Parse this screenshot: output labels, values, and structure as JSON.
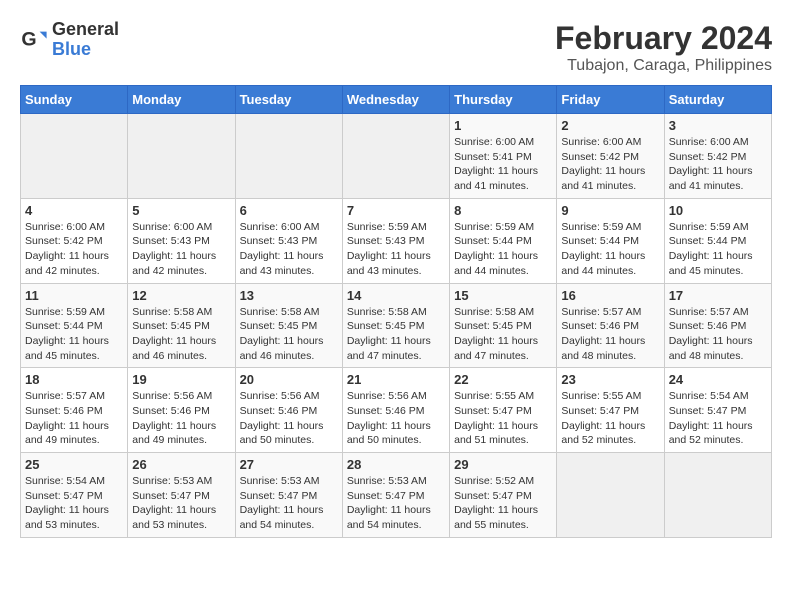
{
  "logo": {
    "text_general": "General",
    "text_blue": "Blue"
  },
  "header": {
    "title": "February 2024",
    "subtitle": "Tubajon, Caraga, Philippines"
  },
  "weekdays": [
    "Sunday",
    "Monday",
    "Tuesday",
    "Wednesday",
    "Thursday",
    "Friday",
    "Saturday"
  ],
  "weeks": [
    [
      {
        "day": "",
        "info": ""
      },
      {
        "day": "",
        "info": ""
      },
      {
        "day": "",
        "info": ""
      },
      {
        "day": "",
        "info": ""
      },
      {
        "day": "1",
        "info": "Sunrise: 6:00 AM\nSunset: 5:41 PM\nDaylight: 11 hours and 41 minutes."
      },
      {
        "day": "2",
        "info": "Sunrise: 6:00 AM\nSunset: 5:42 PM\nDaylight: 11 hours and 41 minutes."
      },
      {
        "day": "3",
        "info": "Sunrise: 6:00 AM\nSunset: 5:42 PM\nDaylight: 11 hours and 41 minutes."
      }
    ],
    [
      {
        "day": "4",
        "info": "Sunrise: 6:00 AM\nSunset: 5:42 PM\nDaylight: 11 hours and 42 minutes."
      },
      {
        "day": "5",
        "info": "Sunrise: 6:00 AM\nSunset: 5:43 PM\nDaylight: 11 hours and 42 minutes."
      },
      {
        "day": "6",
        "info": "Sunrise: 6:00 AM\nSunset: 5:43 PM\nDaylight: 11 hours and 43 minutes."
      },
      {
        "day": "7",
        "info": "Sunrise: 5:59 AM\nSunset: 5:43 PM\nDaylight: 11 hours and 43 minutes."
      },
      {
        "day": "8",
        "info": "Sunrise: 5:59 AM\nSunset: 5:44 PM\nDaylight: 11 hours and 44 minutes."
      },
      {
        "day": "9",
        "info": "Sunrise: 5:59 AM\nSunset: 5:44 PM\nDaylight: 11 hours and 44 minutes."
      },
      {
        "day": "10",
        "info": "Sunrise: 5:59 AM\nSunset: 5:44 PM\nDaylight: 11 hours and 45 minutes."
      }
    ],
    [
      {
        "day": "11",
        "info": "Sunrise: 5:59 AM\nSunset: 5:44 PM\nDaylight: 11 hours and 45 minutes."
      },
      {
        "day": "12",
        "info": "Sunrise: 5:58 AM\nSunset: 5:45 PM\nDaylight: 11 hours and 46 minutes."
      },
      {
        "day": "13",
        "info": "Sunrise: 5:58 AM\nSunset: 5:45 PM\nDaylight: 11 hours and 46 minutes."
      },
      {
        "day": "14",
        "info": "Sunrise: 5:58 AM\nSunset: 5:45 PM\nDaylight: 11 hours and 47 minutes."
      },
      {
        "day": "15",
        "info": "Sunrise: 5:58 AM\nSunset: 5:45 PM\nDaylight: 11 hours and 47 minutes."
      },
      {
        "day": "16",
        "info": "Sunrise: 5:57 AM\nSunset: 5:46 PM\nDaylight: 11 hours and 48 minutes."
      },
      {
        "day": "17",
        "info": "Sunrise: 5:57 AM\nSunset: 5:46 PM\nDaylight: 11 hours and 48 minutes."
      }
    ],
    [
      {
        "day": "18",
        "info": "Sunrise: 5:57 AM\nSunset: 5:46 PM\nDaylight: 11 hours and 49 minutes."
      },
      {
        "day": "19",
        "info": "Sunrise: 5:56 AM\nSunset: 5:46 PM\nDaylight: 11 hours and 49 minutes."
      },
      {
        "day": "20",
        "info": "Sunrise: 5:56 AM\nSunset: 5:46 PM\nDaylight: 11 hours and 50 minutes."
      },
      {
        "day": "21",
        "info": "Sunrise: 5:56 AM\nSunset: 5:46 PM\nDaylight: 11 hours and 50 minutes."
      },
      {
        "day": "22",
        "info": "Sunrise: 5:55 AM\nSunset: 5:47 PM\nDaylight: 11 hours and 51 minutes."
      },
      {
        "day": "23",
        "info": "Sunrise: 5:55 AM\nSunset: 5:47 PM\nDaylight: 11 hours and 52 minutes."
      },
      {
        "day": "24",
        "info": "Sunrise: 5:54 AM\nSunset: 5:47 PM\nDaylight: 11 hours and 52 minutes."
      }
    ],
    [
      {
        "day": "25",
        "info": "Sunrise: 5:54 AM\nSunset: 5:47 PM\nDaylight: 11 hours and 53 minutes."
      },
      {
        "day": "26",
        "info": "Sunrise: 5:53 AM\nSunset: 5:47 PM\nDaylight: 11 hours and 53 minutes."
      },
      {
        "day": "27",
        "info": "Sunrise: 5:53 AM\nSunset: 5:47 PM\nDaylight: 11 hours and 54 minutes."
      },
      {
        "day": "28",
        "info": "Sunrise: 5:53 AM\nSunset: 5:47 PM\nDaylight: 11 hours and 54 minutes."
      },
      {
        "day": "29",
        "info": "Sunrise: 5:52 AM\nSunset: 5:47 PM\nDaylight: 11 hours and 55 minutes."
      },
      {
        "day": "",
        "info": ""
      },
      {
        "day": "",
        "info": ""
      }
    ]
  ]
}
